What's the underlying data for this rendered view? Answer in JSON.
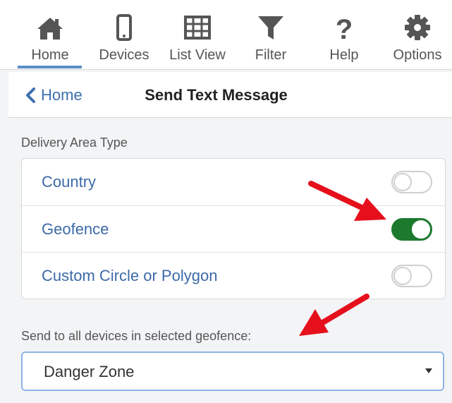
{
  "nav": {
    "items": [
      {
        "label": "Home",
        "icon": "home-icon"
      },
      {
        "label": "Devices",
        "icon": "mobile-icon"
      },
      {
        "label": "List View",
        "icon": "table-icon"
      },
      {
        "label": "Filter",
        "icon": "filter-icon"
      },
      {
        "label": "Help",
        "icon": "question-icon"
      },
      {
        "label": "Options",
        "icon": "gear-icon"
      }
    ],
    "active": "Home"
  },
  "header": {
    "back_label": "Home",
    "title": "Send Text Message"
  },
  "delivery": {
    "section_label": "Delivery Area Type",
    "options": [
      {
        "label": "Country",
        "enabled": false
      },
      {
        "label": "Geofence",
        "enabled": true
      },
      {
        "label": "Custom Circle or Polygon",
        "enabled": false
      }
    ]
  },
  "geofence_select": {
    "label": "Send to all devices in selected geofence:",
    "value": "Danger Zone"
  },
  "colors": {
    "accent": "#3d6aa8",
    "toggle_on": "#1c7a2d",
    "annotation_arrow": "#e5101b",
    "nav_active": "#5b8ec9"
  }
}
